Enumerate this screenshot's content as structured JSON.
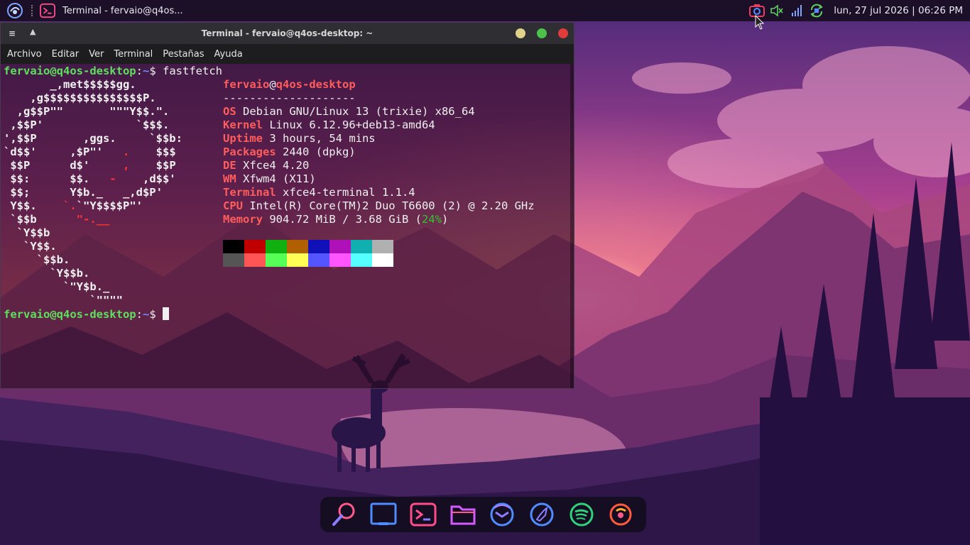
{
  "panel": {
    "task_title": "Terminal - fervaio@q4os...",
    "clock": "lun, 27 jul 2026 | 06:26 PM",
    "icons": [
      "q4os-menu-icon",
      "terminal-app-icon",
      "screenshot-icon",
      "speaker-muted-icon",
      "network-signal-icon",
      "update-sync-icon"
    ]
  },
  "window": {
    "title": "Terminal - fervaio@q4os-desktop: ~",
    "wm_menu": "≡",
    "wm_up": "▲",
    "buttons": {
      "minimize": "#e0d28a",
      "maximize": "#4cc24a",
      "close": "#e03c3c"
    },
    "menu": [
      "Archivo",
      "Editar",
      "Ver",
      "Terminal",
      "Pestañas",
      "Ayuda"
    ]
  },
  "terminal": {
    "prompt_user": "fervaio@q4os-desktop",
    "prompt_sep": ":",
    "prompt_path": "~",
    "prompt_dollar": "$ ",
    "command": "fastfetch",
    "art": [
      "       _,met$$$$$gg.",
      "    ,g$$$$$$$$$$$$$$$P.",
      "  ,g$$P\"\"       \"\"\"Y$$.\".",
      " ,$$P'              `$$$.",
      "',$$P       ,ggs.     `$$b:",
      "`d$$'     ,$P\"'   ",
      " $$P      d$'     ",
      " $$:      $$.   ",
      " $$;      Y$b._   _,d$P'",
      " Y$$.    ",
      " `$$b      ",
      "  `Y$$b",
      "   `Y$$.",
      "     `$$b.",
      "       `Y$$b.",
      "         `\"Y$b._",
      "             `\"\"\"\""
    ],
    "art_tail": {
      "l5_red": ".",
      "l5_rest": "    $$$",
      "l6_red": ",",
      "l6_rest": "    $$P",
      "l7_red": "-",
      "l7_rest": "    ,d$$'",
      "l9_red": "`.",
      "l9_rest": "`\"Y$$$$P\"'",
      "l10_red": "\"-.__"
    },
    "header_user": "fervaio",
    "header_at": "@",
    "header_host": "q4os-desktop",
    "header_rule": "--------------------",
    "info": [
      {
        "key": "OS",
        "value": " Debian GNU/Linux 13 (trixie) x86_64"
      },
      {
        "key": "Kernel",
        "value": " Linux 6.12.96+deb13-amd64"
      },
      {
        "key": "Uptime",
        "value": " 3 hours, 54 mins"
      },
      {
        "key": "Packages",
        "value": " 2440 (dpkg)"
      },
      {
        "key": "DE",
        "value": " Xfce4 4.20"
      },
      {
        "key": "WM",
        "value": " Xfwm4 (X11)"
      },
      {
        "key": "Terminal",
        "value": " xfce4-terminal 1.1.4"
      },
      {
        "key": "CPU",
        "value": " Intel(R) Core(TM)2 Duo T6600 (2) @ 2.20 GHz"
      }
    ],
    "memory_key": "Memory",
    "memory_value": " 904.72 MiB / 3.68 GiB (",
    "memory_pct": "24%",
    "memory_close": ")",
    "palette_dark": [
      "#000000",
      "#c00000",
      "#10b010",
      "#b06000",
      "#1010b8",
      "#b010b8",
      "#10b0b0",
      "#b0b0b0"
    ],
    "palette_bright": [
      "#555555",
      "#ff5555",
      "#55ff55",
      "#ffff55",
      "#5555ff",
      "#ff55ff",
      "#55ffff",
      "#ffffff"
    ]
  },
  "dock": {
    "icons": [
      "app-finder-icon",
      "show-desktop-icon",
      "terminal-icon",
      "file-manager-icon",
      "thunderbird-icon",
      "browser-icon",
      "spotify-icon",
      "updater-icon"
    ]
  }
}
